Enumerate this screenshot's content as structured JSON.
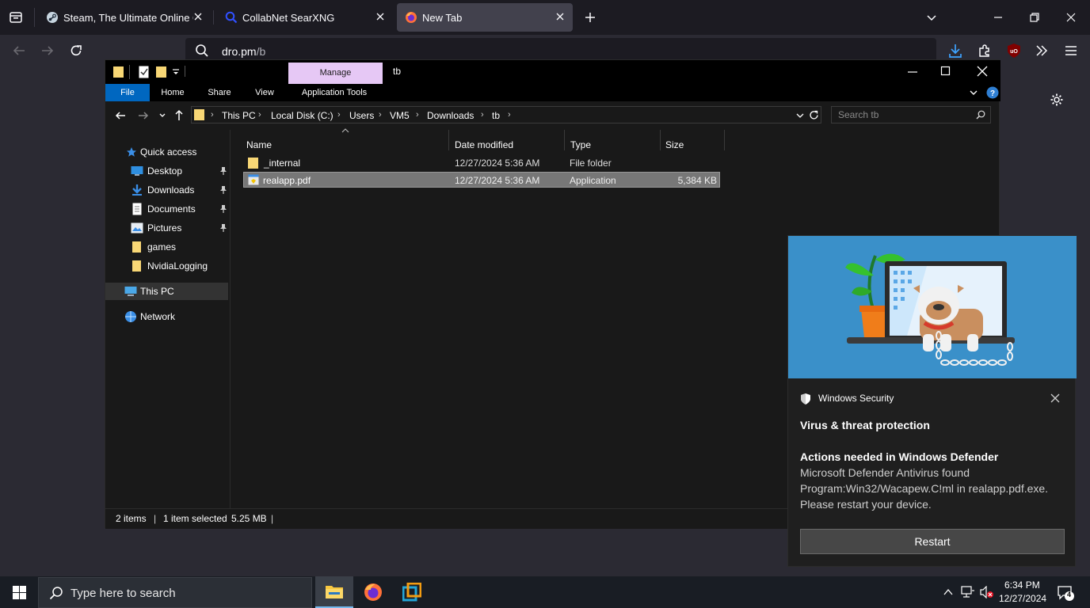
{
  "browser": {
    "tabs": [
      {
        "title": "Steam, The Ultimate Online Gar",
        "favicon": "steam-icon"
      },
      {
        "title": "CollabNet SearXNG",
        "favicon": "search-icon"
      },
      {
        "title": "New Tab",
        "favicon": "firefox-icon",
        "active": true
      }
    ],
    "url_host": "dro.pm",
    "url_path": "/b"
  },
  "explorer": {
    "quick_toolbar_label": "Manage",
    "window_title": "tb",
    "ribbon_tabs": [
      "File",
      "Home",
      "Share",
      "View",
      "Application Tools"
    ],
    "breadcrumb": [
      "This PC",
      "Local Disk (C:)",
      "Users",
      "VM5",
      "Downloads",
      "tb"
    ],
    "search_placeholder": "Search tb",
    "nav": {
      "quick_access": "Quick access",
      "items": [
        {
          "label": "Desktop",
          "icon": "desktop-icon",
          "pinned": true
        },
        {
          "label": "Downloads",
          "icon": "download-arrow-icon",
          "pinned": true
        },
        {
          "label": "Documents",
          "icon": "documents-icon",
          "pinned": true
        },
        {
          "label": "Pictures",
          "icon": "pictures-icon",
          "pinned": true
        },
        {
          "label": "games",
          "icon": "folder-icon",
          "pinned": false
        },
        {
          "label": "NvidiaLogging",
          "icon": "folder-icon",
          "pinned": false
        }
      ],
      "this_pc": "This PC",
      "network": "Network"
    },
    "columns": [
      "Name",
      "Date modified",
      "Type",
      "Size"
    ],
    "files": [
      {
        "name": "_internal",
        "date": "12/27/2024 5:36 AM",
        "type": "File folder",
        "size": ""
      },
      {
        "name": "realapp.pdf",
        "date": "12/27/2024 5:36 AM",
        "type": "Application",
        "size": "5,384 KB",
        "selected": true
      }
    ],
    "status": {
      "count": "2 items",
      "selected": "1 item selected",
      "size": "5.25 MB"
    }
  },
  "toast": {
    "app": "Windows Security",
    "heading": "Virus & threat protection",
    "subheading": "Actions needed in Windows Defender",
    "body_lines": [
      "Microsoft Defender Antivirus found",
      "Program:Win32/Wacapew.C!ml in realapp.pdf.exe.",
      "Please restart your device."
    ],
    "button": "Restart"
  },
  "taskbar": {
    "search_placeholder": "Type here to search",
    "time": "6:34 PM",
    "date": "12/27/2024",
    "notification_count": "4"
  },
  "colors": {
    "firefox_bg": "#1c1b22",
    "toolbar": "#2b2a33",
    "manage_tab": "#e6c8f5",
    "file_tab": "#0067c0",
    "selection": "#777777",
    "toast_hero": "#3a90c9"
  }
}
